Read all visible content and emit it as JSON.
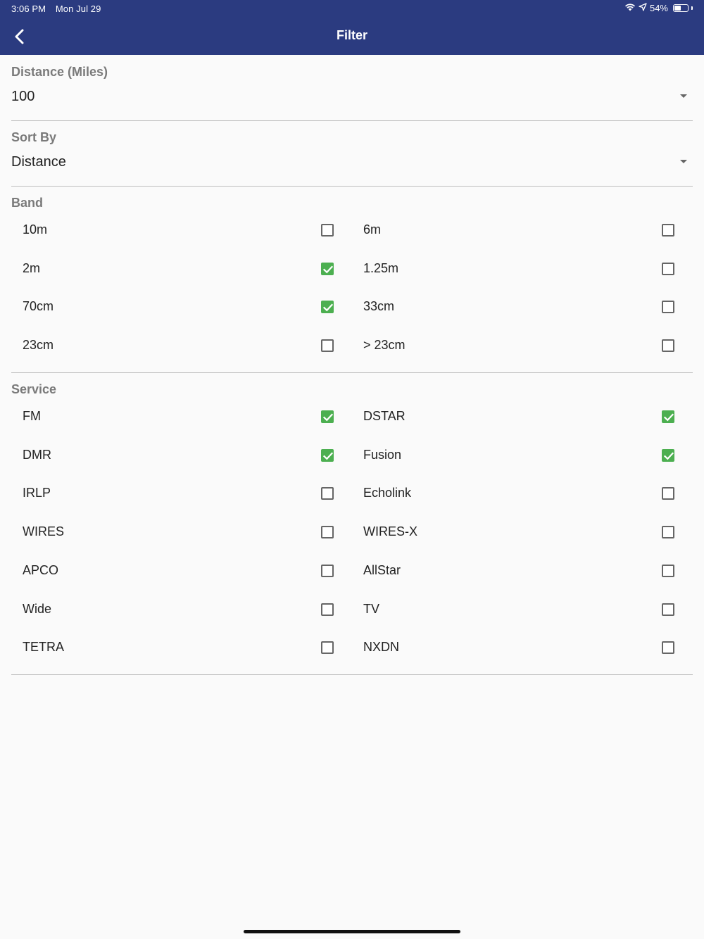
{
  "status_bar": {
    "time": "3:06 PM",
    "date": "Mon Jul 29",
    "battery_percent": "54%",
    "battery_level": 0.54
  },
  "nav": {
    "title": "Filter",
    "back_icon": "chevron-left-icon"
  },
  "distance": {
    "label": "Distance (Miles)",
    "value": "100"
  },
  "sort_by": {
    "label": "Sort By",
    "value": "Distance"
  },
  "band": {
    "label": "Band",
    "items": [
      {
        "label": "10m",
        "checked": false
      },
      {
        "label": "6m",
        "checked": false
      },
      {
        "label": "2m",
        "checked": true
      },
      {
        "label": "1.25m",
        "checked": false
      },
      {
        "label": "70cm",
        "checked": true
      },
      {
        "label": "33cm",
        "checked": false
      },
      {
        "label": "23cm",
        "checked": false
      },
      {
        "label": "> 23cm",
        "checked": false
      }
    ]
  },
  "service": {
    "label": "Service",
    "items": [
      {
        "label": "FM",
        "checked": true
      },
      {
        "label": "DSTAR",
        "checked": true
      },
      {
        "label": "DMR",
        "checked": true
      },
      {
        "label": "Fusion",
        "checked": true
      },
      {
        "label": "IRLP",
        "checked": false
      },
      {
        "label": "Echolink",
        "checked": false
      },
      {
        "label": "WIRES",
        "checked": false
      },
      {
        "label": "WIRES-X",
        "checked": false
      },
      {
        "label": "APCO",
        "checked": false
      },
      {
        "label": "AllStar",
        "checked": false
      },
      {
        "label": "Wide",
        "checked": false
      },
      {
        "label": "TV",
        "checked": false
      },
      {
        "label": "TETRA",
        "checked": false
      },
      {
        "label": "NXDN",
        "checked": false
      }
    ]
  },
  "colors": {
    "nav_bar": "#2b3b80",
    "checked": "#4caf50",
    "section_label": "#7a7a7a",
    "background": "#fafafa"
  }
}
